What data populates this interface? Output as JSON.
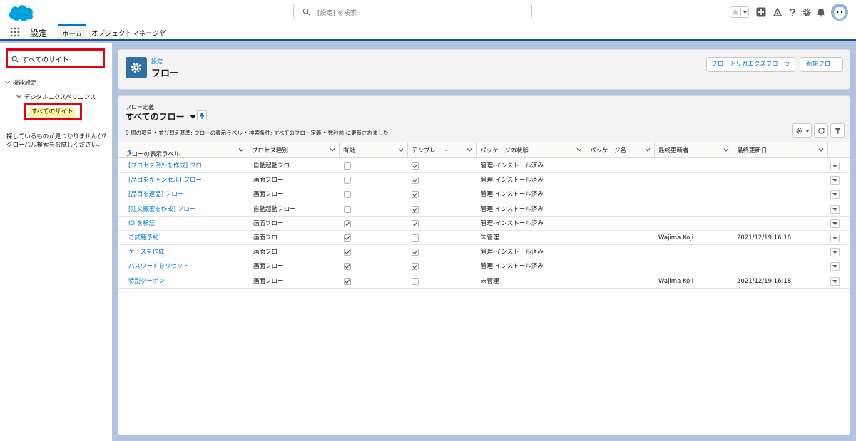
{
  "header": {
    "search_placeholder": "[設定] を検索"
  },
  "context": {
    "app_name": "設定",
    "tabs": [
      "ホーム",
      "オブジェクトマネージャ"
    ]
  },
  "sidebar": {
    "quick_find_value": "すべてのサイト",
    "tree_level1": "機能設定",
    "tree_level2": "デジタルエクスペリエンス",
    "tree_leaf": "すべてのサイト",
    "not_found_line1": "探しているものが見つかりませんか?",
    "not_found_line2": "グローバル検索をお試しください。"
  },
  "page_header": {
    "breadcrumb": "設定",
    "title": "フロー",
    "buttons": [
      "フロートリガエクスプローラ",
      "新規フロー"
    ]
  },
  "list_view": {
    "object_label": "フロー定義",
    "view_name": "すべてのフロー",
    "meta": "9 個の項目 • 並び替え基準: フローの表示ラベル • 検索条件: すべてのフロー定義 • 数秒前 に更新されました",
    "columns": [
      "フローの表示ラベル",
      "プロセス種別",
      "有効",
      "テンプレート",
      "パッケージの状態",
      "パッケージ名",
      "最終更新者",
      "最終更新日"
    ],
    "sort_indicator": "↑",
    "rows": [
      {
        "label": "[プロセス例外を作成] フロー",
        "process": "自動起動フロー",
        "active": false,
        "template": true,
        "status": "管理-インストール済み",
        "package": "",
        "modified_by": "",
        "modified_date": ""
      },
      {
        "label": "[品目をキャンセル] フロー",
        "process": "画面フロー",
        "active": false,
        "template": true,
        "status": "管理-インストール済み",
        "package": "",
        "modified_by": "",
        "modified_date": ""
      },
      {
        "label": "[品目を返品] フロー",
        "process": "画面フロー",
        "active": false,
        "template": true,
        "status": "管理-インストール済み",
        "package": "",
        "modified_by": "",
        "modified_date": ""
      },
      {
        "label": "[注文概要を作成] フロー",
        "process": "自動起動フロー",
        "active": false,
        "template": true,
        "status": "管理-インストール済み",
        "package": "",
        "modified_by": "",
        "modified_date": ""
      },
      {
        "label": "ID を検証",
        "process": "画面フロー",
        "active": true,
        "template": true,
        "status": "管理-インストール済み",
        "package": "",
        "modified_by": "",
        "modified_date": ""
      },
      {
        "label": "ご試聴予約",
        "process": "画面フロー",
        "active": true,
        "template": false,
        "status": "未管理",
        "package": "",
        "modified_by": "Wajima Koji",
        "modified_date": "2021/12/19 16:18"
      },
      {
        "label": "ケースを作成",
        "process": "画面フロー",
        "active": true,
        "template": true,
        "status": "管理-インストール済み",
        "package": "",
        "modified_by": "",
        "modified_date": ""
      },
      {
        "label": "パスワードをリセット",
        "process": "画面フロー",
        "active": true,
        "template": true,
        "status": "管理-インストール済み",
        "package": "",
        "modified_by": "",
        "modified_date": ""
      },
      {
        "label": "特別クーポン",
        "process": "画面フロー",
        "active": true,
        "template": false,
        "status": "未管理",
        "package": "",
        "modified_by": "Wajima Koji",
        "modified_date": "2021/12/19 16:18"
      }
    ]
  },
  "colors": {
    "brand": "#0176d3",
    "background": "#b0c4df",
    "highlight_border": "#e8000b",
    "highlight_fill": "#fff59d"
  }
}
